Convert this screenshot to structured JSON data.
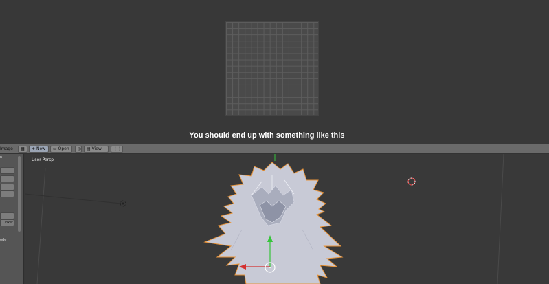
{
  "caption": "You should end up with something like this",
  "header": {
    "image_menu": "Image",
    "new_label": "New",
    "open_label": "Open",
    "view_label": "View"
  },
  "toolshelf": {
    "label_top": "n",
    "label_blanket": "nket",
    "label_mode": "ode"
  },
  "viewport": {
    "label": "User Persp"
  },
  "colors": {
    "background": "#383838",
    "header": "#6a6a6a",
    "mesh": "#c8cad6",
    "outline": "#e8943a",
    "gizmo_y": "#35c43a",
    "gizmo_x": "#d43030"
  },
  "icons": [
    "image-editor-icon",
    "add-icon",
    "folder-icon",
    "pin-icon",
    "view-icon",
    "camera-icon",
    "light-icon",
    "cursor-icon"
  ]
}
